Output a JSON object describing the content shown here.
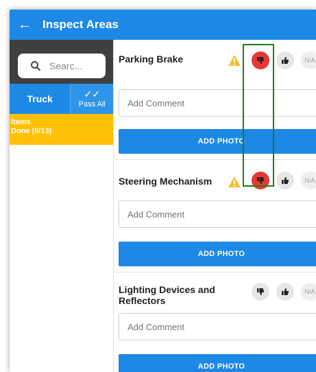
{
  "appbar": {
    "back_icon": "arrow-left-icon",
    "title": "Inspect Areas"
  },
  "sidebar": {
    "search_placeholder": "Searc...",
    "tab_truck": "Truck",
    "pass_all_label": "Pass All",
    "items_label": "Items",
    "items_done": "Done (0/13)"
  },
  "items": [
    {
      "title": "Parking Brake",
      "warning": true,
      "selected": "fail",
      "comment_placeholder": "Add Comment",
      "photo_label": "ADD PHOTO",
      "na_label": "N/A"
    },
    {
      "title": "Steering Mechanism",
      "warning": true,
      "selected": "fail",
      "comment_placeholder": "Add Comment",
      "photo_label": "ADD PHOTO",
      "na_label": "N/A"
    },
    {
      "title_line1": "Lighting Devices and",
      "title_line2": "Reflectors",
      "warning": false,
      "selected": "none",
      "comment_placeholder": "Add Comment",
      "photo_label": "ADD PHOTO",
      "na_label": "N/A"
    }
  ],
  "colors": {
    "primary": "#1e88e5",
    "warning": "#fbc02d",
    "fail": "#e53935",
    "items_banner": "#ffc107",
    "highlight": "#1f7a1f"
  }
}
